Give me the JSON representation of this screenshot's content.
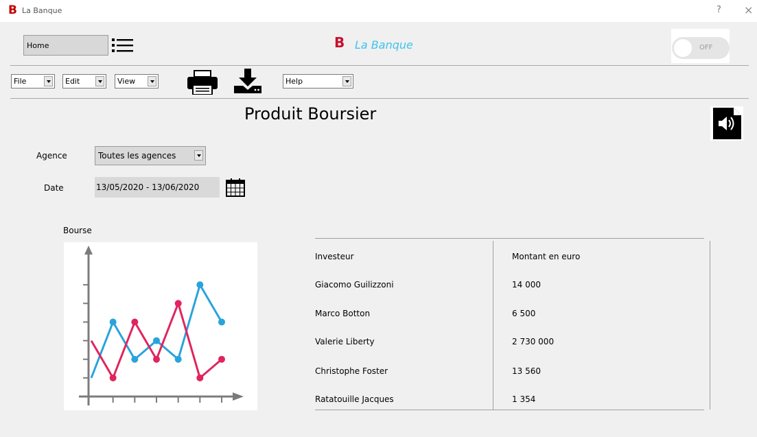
{
  "window": {
    "title": "La Banque",
    "logo_letter": "B",
    "help": "?",
    "close": "×"
  },
  "header": {
    "home_label": "Home",
    "brand_letter": "B",
    "brand_name": "La Banque",
    "toggle_label": "OFF",
    "toggle_state": "off",
    "brand_color": "#c8102e",
    "brand_name_color": "#3ec4ee"
  },
  "menubar": {
    "file": "File",
    "edit": "Edit",
    "view": "View",
    "help": "Help"
  },
  "page": {
    "title": "Produit Boursier",
    "agency_label": "Agence",
    "agency_value": "Toutes les agences",
    "date_label": "Date",
    "date_value": "13/05/2020 - 13/06/2020",
    "chart_label": "Bourse"
  },
  "icons": [
    "list-icon",
    "printer-icon",
    "download-icon",
    "audio-file-icon",
    "calendar-icon"
  ],
  "table": {
    "headers": [
      "Investeur",
      "Montant en euro"
    ],
    "rows": [
      [
        "Giacomo Guilizzoni",
        "14 000"
      ],
      [
        "Marco Botton",
        "6 500"
      ],
      [
        "Valerie Liberty",
        "2 730 000"
      ],
      [
        "Christophe Foster",
        "13 560"
      ],
      [
        "Ratatouille Jacques",
        "1 354"
      ]
    ]
  },
  "chart_data": {
    "type": "line",
    "series": [
      {
        "color": "#29a3dc",
        "values": [
          1,
          4,
          2,
          3,
          2,
          6,
          4
        ]
      },
      {
        "color": "#e0245e",
        "values": [
          3,
          1,
          4,
          2,
          5,
          1,
          2
        ]
      }
    ],
    "ylim": [
      0,
      7
    ],
    "grid": false
  }
}
